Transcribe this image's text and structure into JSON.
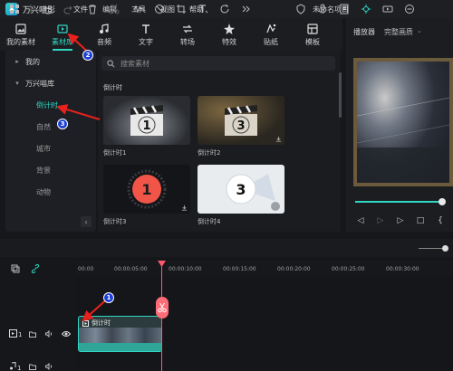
{
  "app": {
    "name": "万兴喵影",
    "document_title": "未命名项目"
  },
  "menu": [
    "文件",
    "编辑",
    "工具",
    "视图",
    "帮助"
  ],
  "toolbar": [
    {
      "label": "我的素材",
      "icon": "image-icon"
    },
    {
      "label": "素材库",
      "icon": "library-icon",
      "active": true
    },
    {
      "label": "音频",
      "icon": "music-note-icon"
    },
    {
      "label": "文字",
      "icon": "text-icon"
    },
    {
      "label": "转场",
      "icon": "transition-icon"
    },
    {
      "label": "特效",
      "icon": "effects-icon"
    },
    {
      "label": "贴纸",
      "icon": "sticker-icon"
    },
    {
      "label": "模板",
      "icon": "template-icon"
    }
  ],
  "sidebar": {
    "items": [
      {
        "label": "我的",
        "type": "group",
        "caret": "▸"
      },
      {
        "label": "万兴喵库",
        "type": "group",
        "caret": "▾"
      },
      {
        "label": "倒计时",
        "type": "item",
        "selected": true
      },
      {
        "label": "自然",
        "type": "item"
      },
      {
        "label": "城市",
        "type": "item"
      },
      {
        "label": "背景",
        "type": "item"
      },
      {
        "label": "动物",
        "type": "item"
      }
    ],
    "collapse_glyph": "‹"
  },
  "library": {
    "search_placeholder": "搜索素材",
    "section_title": "倒计时",
    "cards": [
      {
        "label": "倒计时1",
        "number": "1"
      },
      {
        "label": "倒计时2",
        "number": "3"
      },
      {
        "label": "倒计时3",
        "number": "1"
      },
      {
        "label": "倒计时4",
        "number": "3"
      }
    ]
  },
  "preview": {
    "label": "播放器",
    "quality": "完整画质",
    "quality_caret": "⌄"
  },
  "player_controls": {
    "prev": "◁",
    "play_small": "▷",
    "play": "▷",
    "stop": "□",
    "more": "{"
  },
  "timeline": {
    "ruler_labels": [
      "00:00",
      "00:00:05:00",
      "00:00:10:00",
      "00:00:15:00",
      "00:00:20:00",
      "00:00:25:00",
      "00:00:30:00"
    ],
    "clip_name": "倒计时"
  },
  "annotations": {
    "badges": [
      "1",
      "2",
      "3"
    ]
  },
  "colors": {
    "accent": "#2fd8c3",
    "playhead": "#ff5a6a",
    "badge": "#1b3fd6",
    "arrow": "#e8211c"
  }
}
